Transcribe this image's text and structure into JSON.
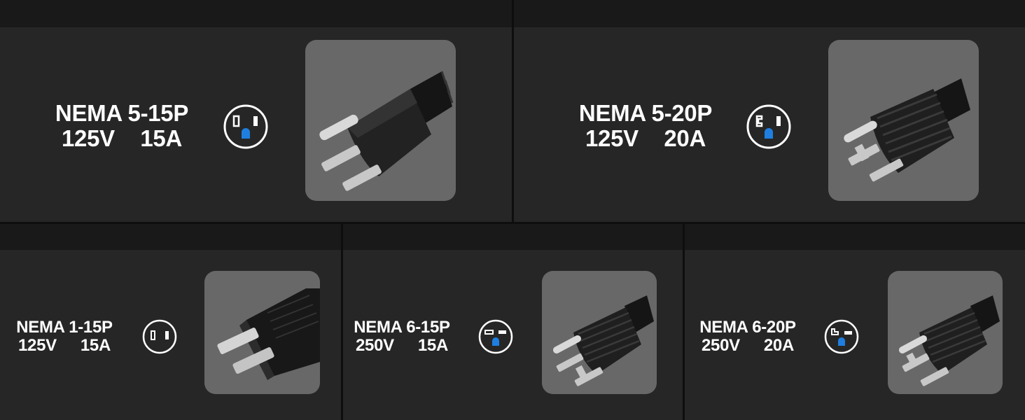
{
  "plugs": [
    {
      "name": "NEMA 5-15P",
      "voltage": "125V",
      "amperage": "15A",
      "icon": "nema-5-15-outlet-icon",
      "photo": "nema-5-15p-plug-photo"
    },
    {
      "name": "NEMA 5-20P",
      "voltage": "125V",
      "amperage": "20A",
      "icon": "nema-5-20-outlet-icon",
      "photo": "nema-5-20p-plug-photo"
    },
    {
      "name": "NEMA 1-15P",
      "voltage": "125V",
      "amperage": "15A",
      "icon": "nema-1-15-outlet-icon",
      "photo": "nema-1-15p-plug-photo"
    },
    {
      "name": "NEMA 6-15P",
      "voltage": "250V",
      "amperage": "15A",
      "icon": "nema-6-15-outlet-icon",
      "photo": "nema-6-15p-plug-photo"
    },
    {
      "name": "NEMA 6-20P",
      "voltage": "250V",
      "amperage": "20A",
      "icon": "nema-6-20-outlet-icon",
      "photo": "nema-6-20p-plug-photo"
    }
  ],
  "colors": {
    "background": "#262626",
    "header_strip": "#191919",
    "photo_bg": "#686868",
    "ground_pin": "#1e7fe0",
    "text": "#ffffff"
  }
}
